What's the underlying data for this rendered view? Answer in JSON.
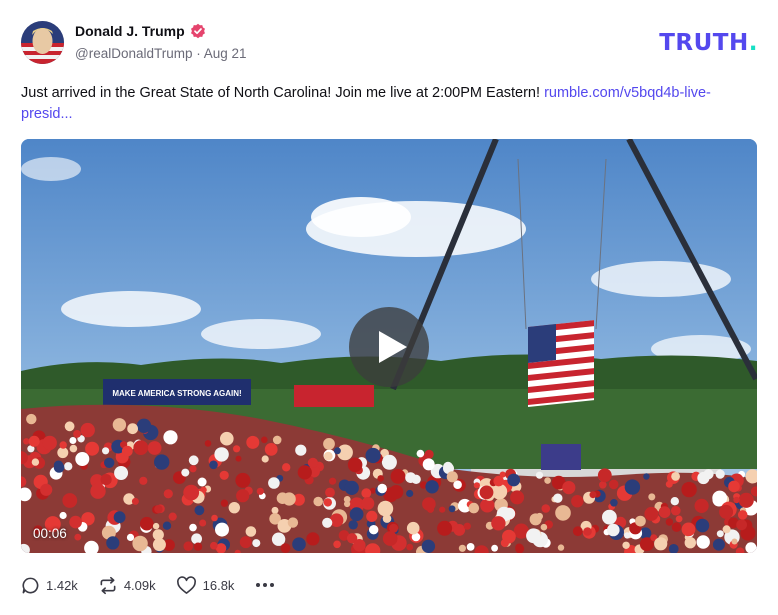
{
  "author": {
    "name": "Donald J. Trump",
    "handle": "@realDonaldTrump",
    "date": "Aug 21",
    "verified_color": "#e5446d"
  },
  "brand": {
    "name": "TRUTH",
    "dot": ".",
    "color": "#5448ee",
    "dot_color": "#17e0c4"
  },
  "post": {
    "text": "Just arrived in the Great State of North Carolina! Join me live at 2:00PM Eastern! ",
    "link": "rumble.com/v5bqd4b-live-presid..."
  },
  "video": {
    "duration": "00:06",
    "banner_text": "MAKE AMERICA STRONG AGAIN!"
  },
  "actions": {
    "replies": "1.42k",
    "retruths": "4.09k",
    "likes": "16.8k"
  },
  "icons": [
    "verified-icon",
    "play-icon",
    "reply-icon",
    "retruth-icon",
    "like-icon",
    "more-icon"
  ]
}
